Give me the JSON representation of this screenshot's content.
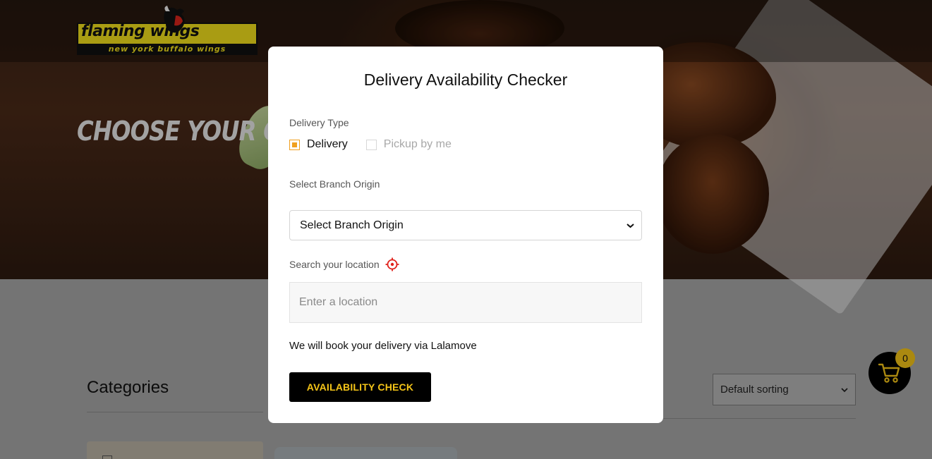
{
  "brand": {
    "logo_top": "flaming wings",
    "logo_bottom": "new york buffalo wings"
  },
  "hero": {
    "title": "CHOOSE YOUR CRA"
  },
  "page": {
    "categories_title": "Categories",
    "sort_selected": "Default sorting",
    "cart_count": "0"
  },
  "modal": {
    "title": "Delivery Availability Checker",
    "delivery_type_label": "Delivery Type",
    "options": [
      {
        "label": "Delivery",
        "checked": true
      },
      {
        "label": "Pickup by me",
        "checked": false
      }
    ],
    "branch_label": "Select Branch Origin",
    "branch_selected": "Select Branch Origin",
    "location_label": "Search your location",
    "location_placeholder": "Enter a location",
    "note": "We will book your delivery via Lalamove",
    "button_label": "AVAILABILITY CHECK"
  },
  "colors": {
    "accent": "#f5c518",
    "checkbox_active": "#f0a020",
    "locate_icon": "#e0201a"
  }
}
